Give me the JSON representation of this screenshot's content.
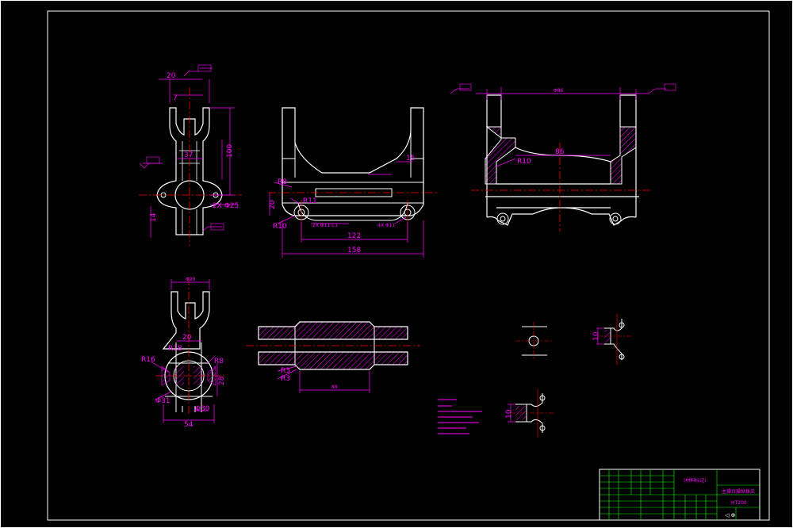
{
  "colors": {
    "background": "#000000",
    "border": "#ffffff",
    "outline": "#ffffff",
    "dimension": "#ff00ff",
    "centerline": "#ff0000",
    "hatch": "#ff00ff",
    "titleblock_grid": "#00ff00"
  },
  "top_view": {
    "dims": {
      "d20": "20",
      "d7": "7",
      "d100": "100",
      "d37": "37",
      "hole_spec": "2X Φ25",
      "d14": "14"
    }
  },
  "front_view": {
    "dims": {
      "r8": "R8",
      "r11": "R11",
      "d20": "20",
      "r10": "R10",
      "d15": "15",
      "d122": "122",
      "d158": "158"
    }
  },
  "section_view": {
    "dims": {
      "r10": "R10",
      "d86": "86"
    }
  },
  "side_view": {
    "dims": {
      "d20": "20",
      "r16": "R16",
      "r18": "R18",
      "r8": "R8",
      "d28": "28",
      "d31": "Φ31",
      "d30": "Φ30",
      "d54": "54"
    }
  },
  "bar_section": {
    "dims": {
      "r3a": "R3",
      "r3b": "R3"
    }
  },
  "detail_views": {
    "dims": {
      "d10a": "10",
      "d10b": "10"
    }
  },
  "title_block": {
    "part_name": "主操台操纵拨叉",
    "material": "HT200"
  }
}
